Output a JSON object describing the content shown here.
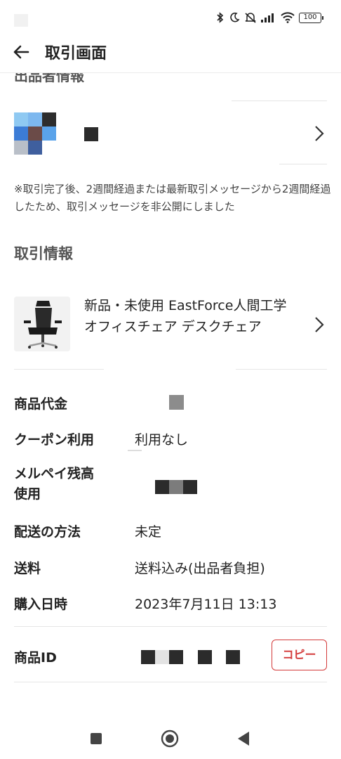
{
  "status_bar": {
    "battery": "100"
  },
  "header": {
    "title": "取引画面"
  },
  "seller_section": {
    "title": "出品者情報"
  },
  "notice": "※取引完了後、2週間経過または最新取引メッセージから2週間経過したため、取引メッセージを非公開にしました",
  "transaction_section": {
    "title": "取引情報",
    "product_name": "新品・未使用 EastForce人間工学 オフィスチェア デスクチェア"
  },
  "details": {
    "price_label": "商品代金",
    "coupon_label": "クーポン利用",
    "coupon_value": "利用なし",
    "merpay_label": "メルペイ残高使用",
    "shipping_method_label": "配送の方法",
    "shipping_method_value": "未定",
    "shipping_fee_label": "送料",
    "shipping_fee_value": "送料込み(出品者負担)",
    "purchase_date_label": "購入日時",
    "purchase_date_value": "2023年7月11日 13:13",
    "item_id_label": "商品ID",
    "copy_label": "コピー"
  },
  "colors": {
    "accent": "#d33a3a",
    "text": "#222222",
    "muted": "#555555",
    "divider": "#e6e6e6"
  },
  "icons": {
    "back": "arrow-left-icon",
    "chevron": "chevron-right-icon",
    "nav_recent": "square-icon",
    "nav_home": "circle-icon",
    "nav_back": "triangle-back-icon"
  }
}
